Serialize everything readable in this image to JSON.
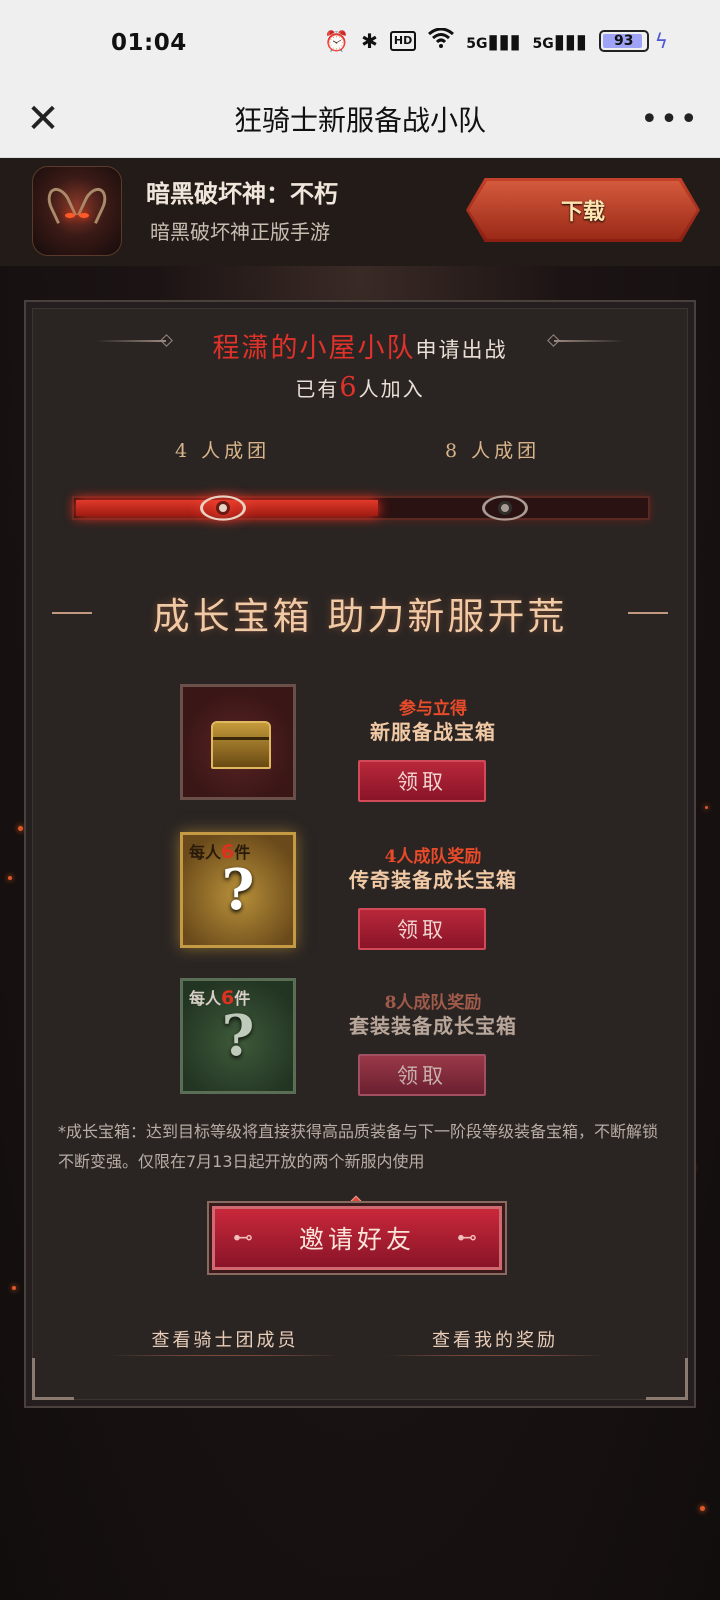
{
  "status_bar": {
    "time": "01:04",
    "battery_level": "93",
    "icons": [
      "alarm-icon",
      "bluetooth-icon",
      "hd-icon",
      "wifi-icon",
      "signal-5g-icon",
      "signal-5g-icon",
      "battery-icon",
      "charging-icon"
    ],
    "hd_text": "HD",
    "signal_label_1": "5G",
    "signal_label_2": "5G"
  },
  "title_bar": {
    "title": "狂骑士新服备战小队",
    "close_glyph": "✕",
    "more_glyph": "•••"
  },
  "app_banner": {
    "name": "暗黑破坏神：不朽",
    "subtitle": "暗黑破坏神正版手游",
    "download_label": "下载"
  },
  "team": {
    "name": "程潇的小屋小队",
    "action": "申请出战",
    "joined_prefix": "已有",
    "joined_count": "6",
    "joined_suffix": "人加入"
  },
  "progress": {
    "tier1_label": "4 人成团",
    "tier2_label": "8 人成团",
    "fill_fraction": 0.53
  },
  "section_title": "成长宝箱 助力新服开荒",
  "rewards": [
    {
      "sub": "参与立得",
      "name": "新服备战宝箱",
      "claim_label": "领取"
    },
    {
      "per_prefix": "每人",
      "per_count": "6",
      "per_suffix": "件",
      "sub": "4人成队奖励",
      "name": "传奇装备成长宝箱",
      "claim_label": "领取"
    },
    {
      "per_prefix": "每人",
      "per_count": "6",
      "per_suffix": "件",
      "sub": "8人成队奖励",
      "name": "套装装备成长宝箱",
      "claim_label": "领取"
    }
  ],
  "note": "*成长宝箱：达到目标等级将直接获得高品质装备与下一阶段等级装备宝箱，不断解锁不断变强。仅限在7月13日起开放的两个新服内使用",
  "invite_label": "邀请好友",
  "links": {
    "members": "查看骑士团成员",
    "my_rewards": "查看我的奖励"
  },
  "colors": {
    "accent_red": "#e0322a",
    "gold": "#f1c9a5",
    "button_red": "#b8283a"
  }
}
